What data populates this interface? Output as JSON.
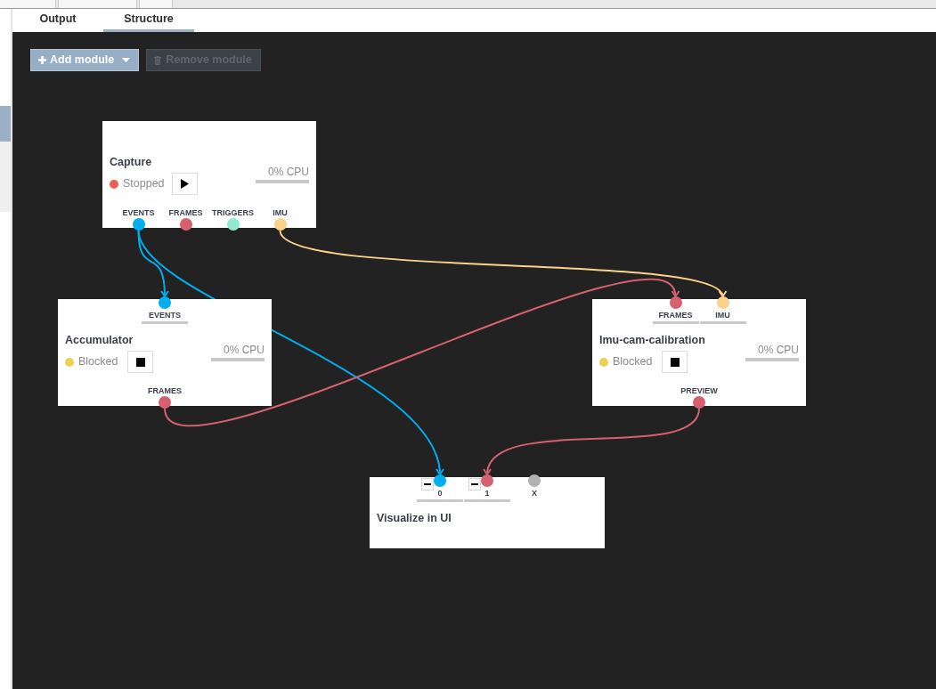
{
  "tabs": [
    {
      "label": "Output",
      "selected": false
    },
    {
      "label": "Structure",
      "selected": true
    }
  ],
  "toolbar": {
    "buttons": [
      {
        "label": "Add module",
        "kind": "add",
        "disabled": false
      },
      {
        "label": "Remove module",
        "kind": "remove",
        "disabled": true
      }
    ]
  },
  "nodes": [
    {
      "title": "Capture",
      "status": {
        "label": "Stopped",
        "color": "#ec5f52"
      },
      "running": false,
      "cpu": {
        "reading": "0% CPU",
        "level": 0
      },
      "outputs": [
        {
          "label": "EVENTS",
          "color": "#00adef"
        },
        {
          "label": "FRAMES",
          "color": "#d6606f"
        },
        {
          "label": "TRIGGERS",
          "color": "#91ebd0"
        },
        {
          "label": "IMU",
          "color": "#fcd28a"
        }
      ]
    },
    {
      "title": "Accumulator",
      "status": {
        "label": "Blocked",
        "color": "#ecd250"
      },
      "running": true,
      "cpu": {
        "reading": "0% CPU",
        "level": 0
      },
      "inputs": [
        {
          "label": "EVENTS",
          "color": "#00adef",
          "level": 0,
          "removable": false
        }
      ],
      "outputs": [
        {
          "label": "FRAMES",
          "color": "#d6606f"
        }
      ]
    },
    {
      "title": "Imu-cam-calibration",
      "status": {
        "label": "Blocked",
        "color": "#ecd250"
      },
      "running": true,
      "cpu": {
        "reading": "0% CPU",
        "level": 0
      },
      "inputs": [
        {
          "label": "FRAMES",
          "color": "#d6606f",
          "level": 0,
          "removable": false
        },
        {
          "label": "IMU",
          "color": "#fcd28a",
          "level": 0,
          "removable": false
        }
      ],
      "outputs": [
        {
          "label": "PREVIEW",
          "color": "#d6606f"
        }
      ]
    },
    {
      "title": "Visualize in UI",
      "inputs": [
        {
          "label": "0",
          "color": "#00adef",
          "level": 0,
          "removable": true
        },
        {
          "label": "1",
          "color": "#d6606f",
          "level": 0,
          "removable": true
        },
        {
          "label": "X",
          "color": "#b2b2b2",
          "removable": false
        }
      ]
    }
  ]
}
